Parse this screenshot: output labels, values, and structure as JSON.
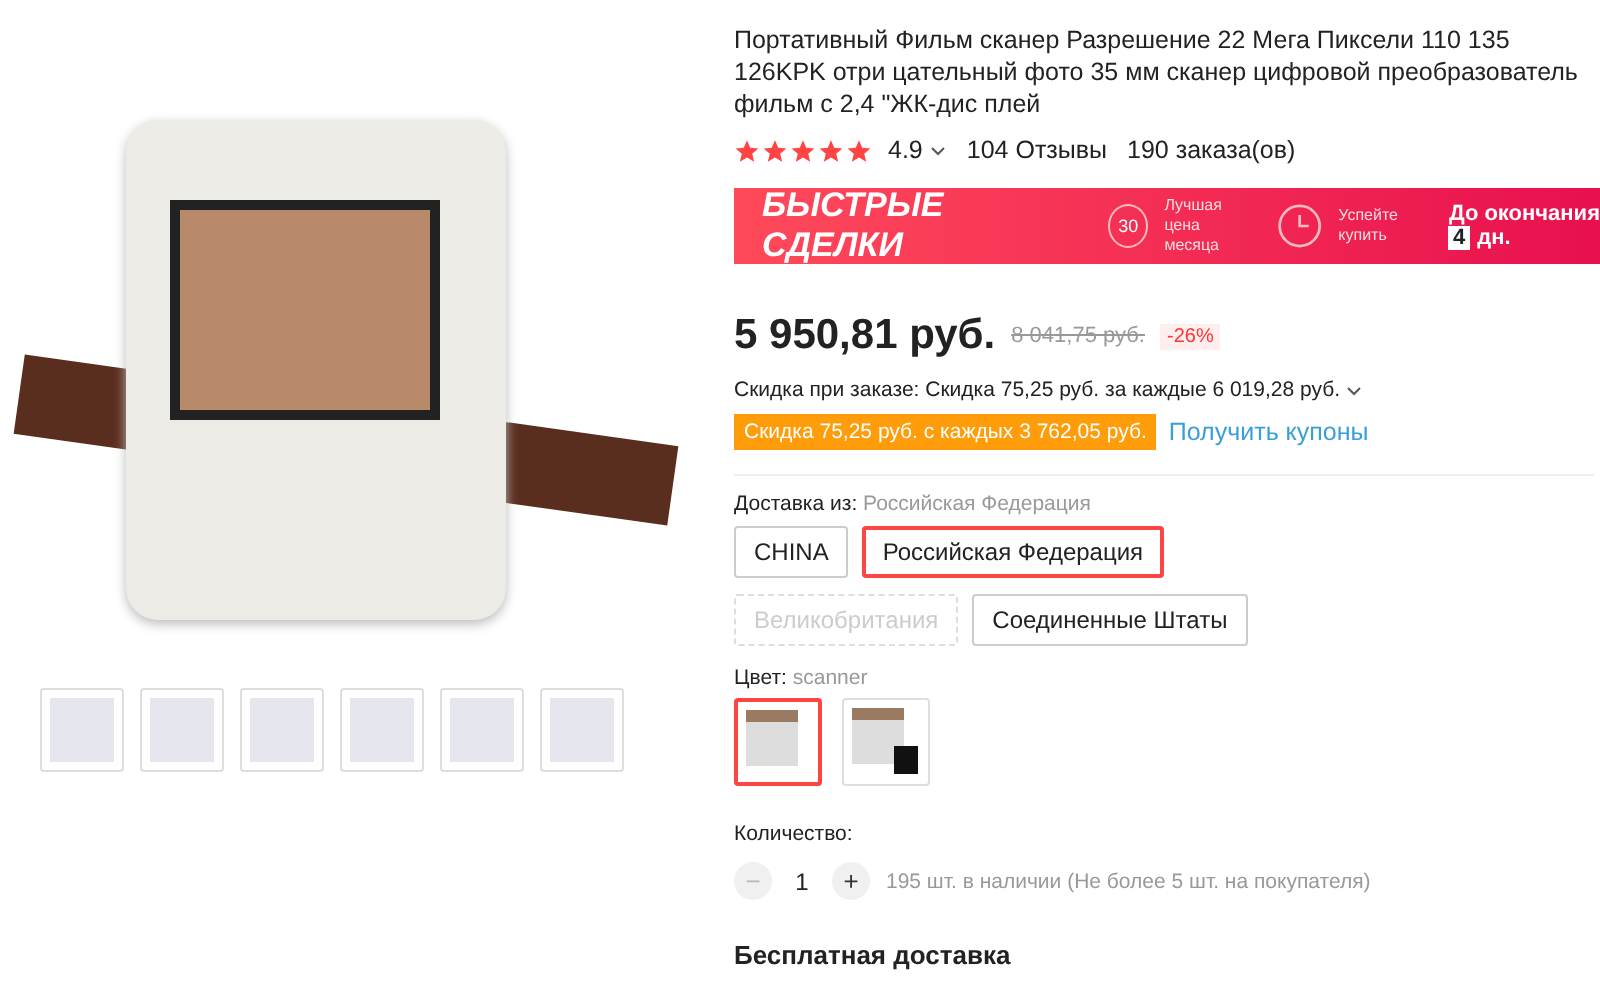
{
  "gallery": {
    "thumbnails": [
      {
        "selected": false
      },
      {
        "selected": false
      },
      {
        "selected": false
      },
      {
        "selected": false
      },
      {
        "selected": false
      },
      {
        "selected": false
      }
    ]
  },
  "product": {
    "title": "Портативный Фильм сканер Разрешение 22 Мега Пиксели 110 135 126KPK отри цательный фото 35 мм сканер цифровой преобразователь фильм с 2,4 \"ЖК-дис плей",
    "stars": 5,
    "rating": "4.9",
    "reviews": "104 Отзывы",
    "orders": "190 заказа(ов)"
  },
  "deals_banner": {
    "title": "БЫСТРЫЕ СДЕЛКИ",
    "badge_number": "30",
    "best_price": "Лучшая цена месяца",
    "hurry": "Успейте купить",
    "ends_label": "До окончания",
    "days_count": "4",
    "days_unit": "дн."
  },
  "price": {
    "current": "5 950,81 руб.",
    "old": "8 041,75 руб.",
    "discount": "-26%"
  },
  "order_discount": "Скидка при заказе: Скидка 75,25 руб. за каждые 6 019,28 руб.",
  "coupon": {
    "label": "Скидка 75,25 руб. с каждых 3 762,05 руб.",
    "link": "Получить купоны"
  },
  "shipping": {
    "label": "Доставка из:",
    "value": "Российская Федерация",
    "options": [
      {
        "label": "CHINA",
        "selected": false,
        "disabled": false
      },
      {
        "label": "Российская Федерация",
        "selected": true,
        "disabled": false
      },
      {
        "label": "Великобритания",
        "selected": false,
        "disabled": true
      },
      {
        "label": "Соединенные Штаты",
        "selected": false,
        "disabled": false
      }
    ]
  },
  "color": {
    "label": "Цвет:",
    "value": "scanner",
    "options": [
      {
        "kind": "scanner",
        "selected": true
      },
      {
        "kind": "bundle",
        "selected": false
      }
    ]
  },
  "quantity": {
    "label": "Количество:",
    "minus": "−",
    "value": "1",
    "plus": "+",
    "stock": "195 шт. в наличии (Не более 5 шт. на покупателя)"
  },
  "free_shipping": "Бесплатная доставка"
}
